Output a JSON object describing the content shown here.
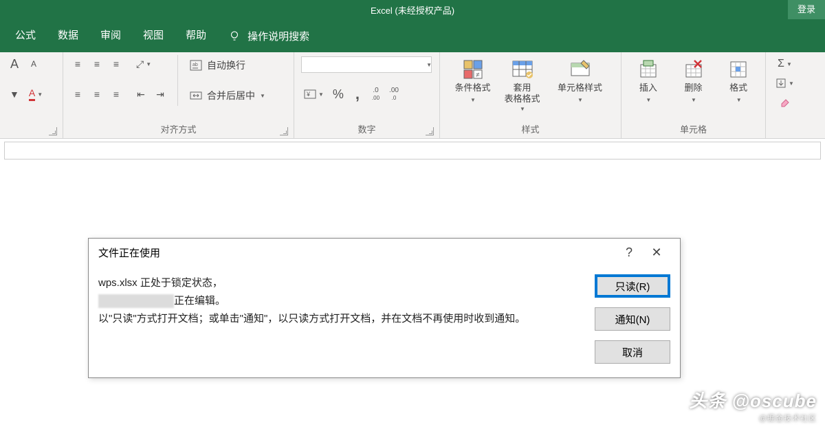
{
  "title": "Excel (未经授权产品)",
  "login": "登录",
  "menu": {
    "formulas": "公式",
    "data": "数据",
    "review": "审阅",
    "view": "视图",
    "help": "帮助",
    "search": "操作说明搜索"
  },
  "ribbon": {
    "font": {
      "increase": "A",
      "decrease": "A"
    },
    "alignment": {
      "wrap": "自动换行",
      "merge": "合并后居中",
      "label": "对齐方式"
    },
    "number": {
      "percent": "%",
      "comma": ",",
      "inc": ".0",
      "dec": ".00",
      "label": "数字"
    },
    "styles": {
      "cond": "条件格式",
      "table": "套用\n表格格式",
      "cell": "单元格样式",
      "label": "样式"
    },
    "cells": {
      "insert": "插入",
      "delete": "删除",
      "format": "格式",
      "label": "单元格"
    },
    "editing": {
      "sum": "Σ"
    }
  },
  "dialog": {
    "title": "文件正在使用",
    "line1a": "wps.xlsx 正处于锁定状态，",
    "line1b": "正在编辑。",
    "line2": "以\"只读\"方式打开文档；或单击\"通知\"，以只读方式打开文档，并在文档不再使用时收到通知。",
    "readonly": "只读(R)",
    "notify": "通知(N)",
    "cancel": "取消",
    "help": "?",
    "close": "✕"
  },
  "watermark": {
    "main": "头条 @oscube",
    "sub": "@掘金技术社区"
  }
}
